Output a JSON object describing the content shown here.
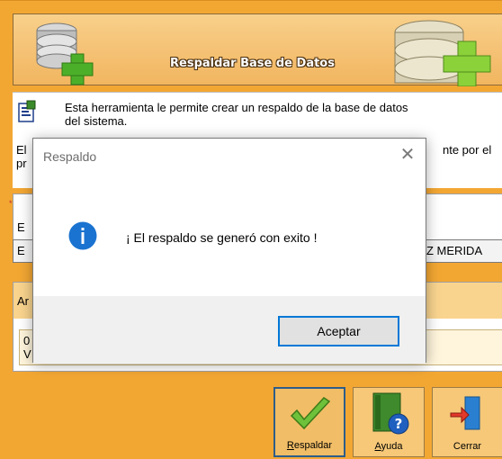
{
  "banner": {
    "title": "Respaldar Base de Datos"
  },
  "info": {
    "description_line1": "Esta herramienta le permite crear un respaldo de la base de datos",
    "description_line2": "del sistema.",
    "partial_left_1": "El",
    "partial_left_2": "pr",
    "partial_right": "nte por el"
  },
  "group": {
    "asterisk": "* ",
    "label_partial": "E",
    "field_left": "E",
    "field_right": "Z MERIDA"
  },
  "log": {
    "header_partial": "Ar",
    "line1_partial": "0",
    "line2_partial": "V"
  },
  "toolbar": {
    "buttons": [
      {
        "label_prefix": "",
        "label_mnemonic": "R",
        "label_rest": "espaldar",
        "icon": "checkmark-icon"
      },
      {
        "label_prefix": "",
        "label_mnemonic": "A",
        "label_rest": "yuda",
        "icon": "help-book-icon"
      },
      {
        "label_prefix": "Cerrar",
        "label_mnemonic": "",
        "label_rest": "",
        "icon": "exit-door-icon"
      }
    ]
  },
  "dialog": {
    "title": "Respaldo",
    "close_glyph": "✕",
    "message": "¡ El respaldo se generó con exito !",
    "ok_label": "Aceptar",
    "icon": "info-icon"
  },
  "colors": {
    "window_bg": "#f3a733",
    "accent_blue": "#0078d7",
    "info_blue": "#1a73d0"
  }
}
